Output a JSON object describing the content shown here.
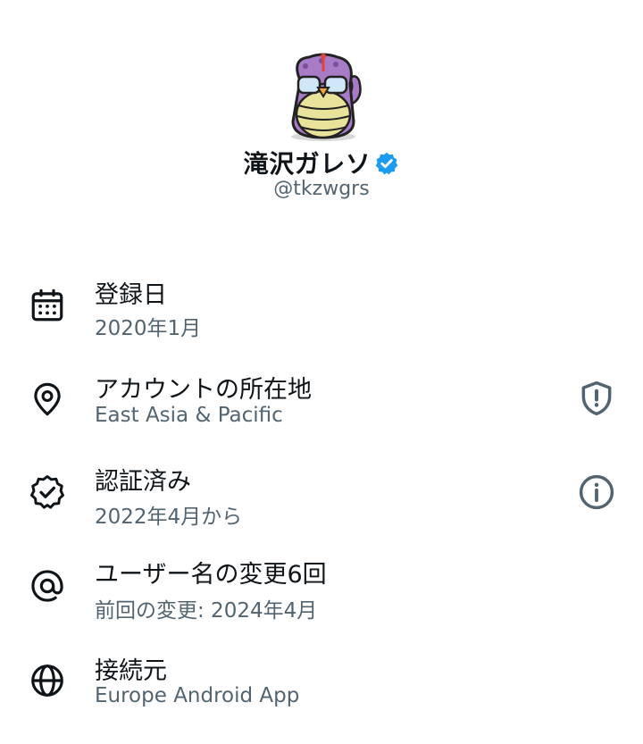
{
  "profile": {
    "display_name": "滝沢ガレソ",
    "handle": "@tkzwgrs",
    "verified": true,
    "verified_color": "#1d9bf0"
  },
  "details": [
    {
      "icon": "calendar-icon",
      "title": "登録日",
      "subtitle": "2020年1月",
      "trailing_icon": null
    },
    {
      "icon": "location-pin-icon",
      "title": "アカウントの所在地",
      "subtitle": "East Asia & Pacific",
      "trailing_icon": "shield-alert-icon"
    },
    {
      "icon": "verified-check-icon",
      "title": "認証済み",
      "subtitle": "2022年4月から",
      "trailing_icon": "info-icon"
    },
    {
      "icon": "at-sign-icon",
      "title": "ユーザー名の変更6回",
      "subtitle": "前回の変更: 2024年4月",
      "trailing_icon": null
    },
    {
      "icon": "globe-icon",
      "title": "接続元",
      "subtitle": "Europe Android App",
      "trailing_icon": null
    }
  ],
  "colors": {
    "primary_text": "#0f1419",
    "secondary_text": "#536471",
    "icon_stroke": "#0f1419",
    "trailing_icon_stroke": "#536471",
    "avatar_purple": "#a77bc6",
    "avatar_belly": "#e8e29a"
  }
}
